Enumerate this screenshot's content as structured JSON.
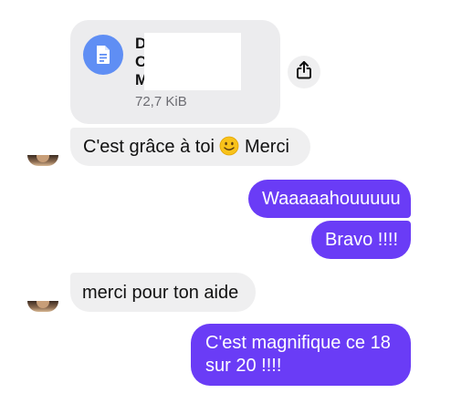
{
  "file": {
    "name": "D  i l C  till  -\nC\nM                x",
    "size": "72,7 KiB"
  },
  "messages": {
    "m1": {
      "text_before": "C'est grâce à toi ",
      "emoji": "smiling-face",
      "text_after": " Merci"
    },
    "m2": "Waaaaahouuuuu",
    "m3": "Bravo !!!!",
    "m4": "merci pour ton aide",
    "m5_line1": "C'est magnifique ce 18",
    "m5_line2": "sur 20 !!!!"
  },
  "colors": {
    "outgoing": "#6a3cf6",
    "incoming": "#efeff0",
    "file_icon": "#5f8ef4"
  },
  "icons": {
    "file": "document-icon",
    "share": "share-upload-icon"
  }
}
